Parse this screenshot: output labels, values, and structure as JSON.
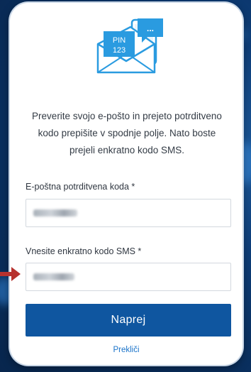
{
  "hero": {
    "envelope_text_line1": "PIN",
    "envelope_text_line2": "123",
    "bubble_text": "..."
  },
  "intro_text": "Preverite svojo e-pošto in prejeto potrditveno kodo prepišite v spodnje polje. Nato boste prejeli enkratno kodo SMS.",
  "email_code": {
    "label": "E-poštna potrditvena koda *",
    "value_obscured": true
  },
  "sms_code": {
    "label": "Vnesite enkratno kodo SMS *",
    "value_obscured": true
  },
  "buttons": {
    "next_label": "Naprej",
    "cancel_label": "Prekliči"
  },
  "colors": {
    "brand_blue": "#0f56a0",
    "icon_blue": "#2a9be0",
    "link_blue": "#1a73c9",
    "arrow_red": "#b7322e",
    "background_navy": "#0a2f5e"
  }
}
